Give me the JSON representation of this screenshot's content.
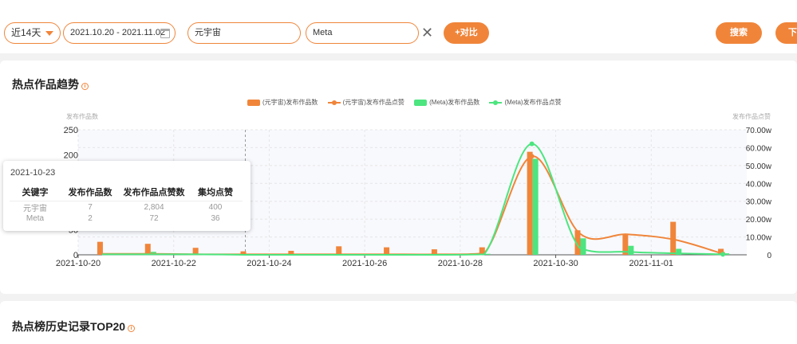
{
  "toolbar": {
    "period": "近14天",
    "date_range": "2021.10.20 - 2021.11.02",
    "keyword1": "元宇宙",
    "keyword2": "Meta",
    "compare_label": "+对比",
    "search_label": "搜索",
    "next_label": "下"
  },
  "trend_card": {
    "title": "热点作品趋势",
    "info": "i"
  },
  "history_card": {
    "title": "热点榜历史记录TOP20",
    "info": "i"
  },
  "colors": {
    "accent": "#f0853a",
    "meta": "#4ce57f"
  },
  "chart_data": {
    "type": "bar",
    "x_ticks": [
      "2021-10-20",
      "2021-10-22",
      "2021-10-24",
      "2021-10-26",
      "2021-10-28",
      "2021-10-30",
      "2021-11-01"
    ],
    "dates": [
      "2021-10-20",
      "2021-10-21",
      "2021-10-22",
      "2021-10-23",
      "2021-10-24",
      "2021-10-25",
      "2021-10-26",
      "2021-10-27",
      "2021-10-28",
      "2021-10-29",
      "2021-10-30",
      "2021-10-31",
      "2021-11-01",
      "2021-11-02"
    ],
    "y_left_label": "发布作品数",
    "y_right_label": "发布作品点赞",
    "y_left_ticks": [
      "250",
      "200",
      "150",
      "100",
      "50",
      "0"
    ],
    "y_right_ticks": [
      "70.00w",
      "60.00w",
      "50.00w",
      "40.00w",
      "30.00w",
      "20.00w",
      "10.00w",
      "0"
    ],
    "ylim_left": [
      0,
      250
    ],
    "ylim_right": [
      0,
      700000
    ],
    "series": [
      {
        "name": "(元宇宙)发布作品数",
        "kind": "bar",
        "axis": "left",
        "color": "#f0853a",
        "values": [
          26,
          22,
          14,
          7,
          8,
          17,
          15,
          11,
          15,
          206,
          49,
          41,
          66,
          12
        ]
      },
      {
        "name": "(元宇宙)发布作品点赞",
        "kind": "line",
        "axis": "left",
        "color": "#f0853a",
        "values": [
          2,
          2,
          1,
          1,
          1,
          1,
          1,
          1,
          3,
          197,
          43,
          41,
          30,
          2
        ]
      },
      {
        "name": "(Meta)发布作品数",
        "kind": "bar",
        "axis": "left",
        "color": "#4ce57f",
        "values": [
          2,
          6,
          1,
          2,
          1,
          2,
          1,
          2,
          2,
          192,
          33,
          18,
          12,
          3
        ]
      },
      {
        "name": "(Meta)发布作品点赞",
        "kind": "line",
        "axis": "left",
        "color": "#4ce57f",
        "values": [
          1,
          1,
          1,
          0,
          0,
          0,
          0,
          0,
          1,
          222,
          14,
          6,
          3,
          1
        ]
      }
    ],
    "tooltip": {
      "date": "2021-10-23",
      "headers": [
        "关键字",
        "发布作品数",
        "发布作品点赞数",
        "集均点赞"
      ],
      "rows": [
        [
          "元宇宙",
          "7",
          "2,804",
          "400"
        ],
        [
          "Meta",
          "2",
          "72",
          "36"
        ]
      ]
    }
  }
}
